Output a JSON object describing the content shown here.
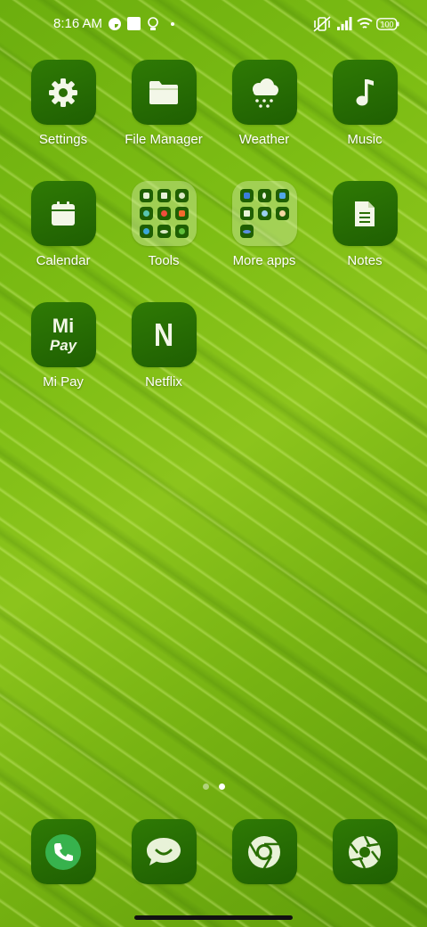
{
  "status_bar": {
    "time": "8:16 AM",
    "battery": "100"
  },
  "apps": [
    {
      "label": "Settings",
      "icon": "gear-icon"
    },
    {
      "label": "File Manager",
      "icon": "folder-icon"
    },
    {
      "label": "Weather",
      "icon": "snow-cloud-icon"
    },
    {
      "label": "Music",
      "icon": "music-note-icon"
    },
    {
      "label": "Calendar",
      "icon": "calendar-icon"
    },
    {
      "label": "Tools",
      "icon": "folder-group-icon"
    },
    {
      "label": "More apps",
      "icon": "folder-group-icon"
    },
    {
      "label": "Notes",
      "icon": "notes-icon"
    },
    {
      "label": "Mi Pay",
      "icon": "mi-pay-icon"
    },
    {
      "label": "Netflix",
      "icon": "netflix-n-icon"
    }
  ],
  "mipay_logo": {
    "line1": "Mi",
    "line2": "Pay"
  },
  "netflix_logo": "N",
  "dock": [
    {
      "name": "phone",
      "icon": "phone-icon"
    },
    {
      "name": "messaging",
      "icon": "chat-bubble-icon"
    },
    {
      "name": "browser",
      "icon": "chrome-icon"
    },
    {
      "name": "camera",
      "icon": "camera-aperture-icon"
    }
  ],
  "page_indicator": {
    "count": 2,
    "active_index": 1
  },
  "colors": {
    "tile": "#1f5f02",
    "accent_green": "#37b24d",
    "label": "#ffffff"
  }
}
